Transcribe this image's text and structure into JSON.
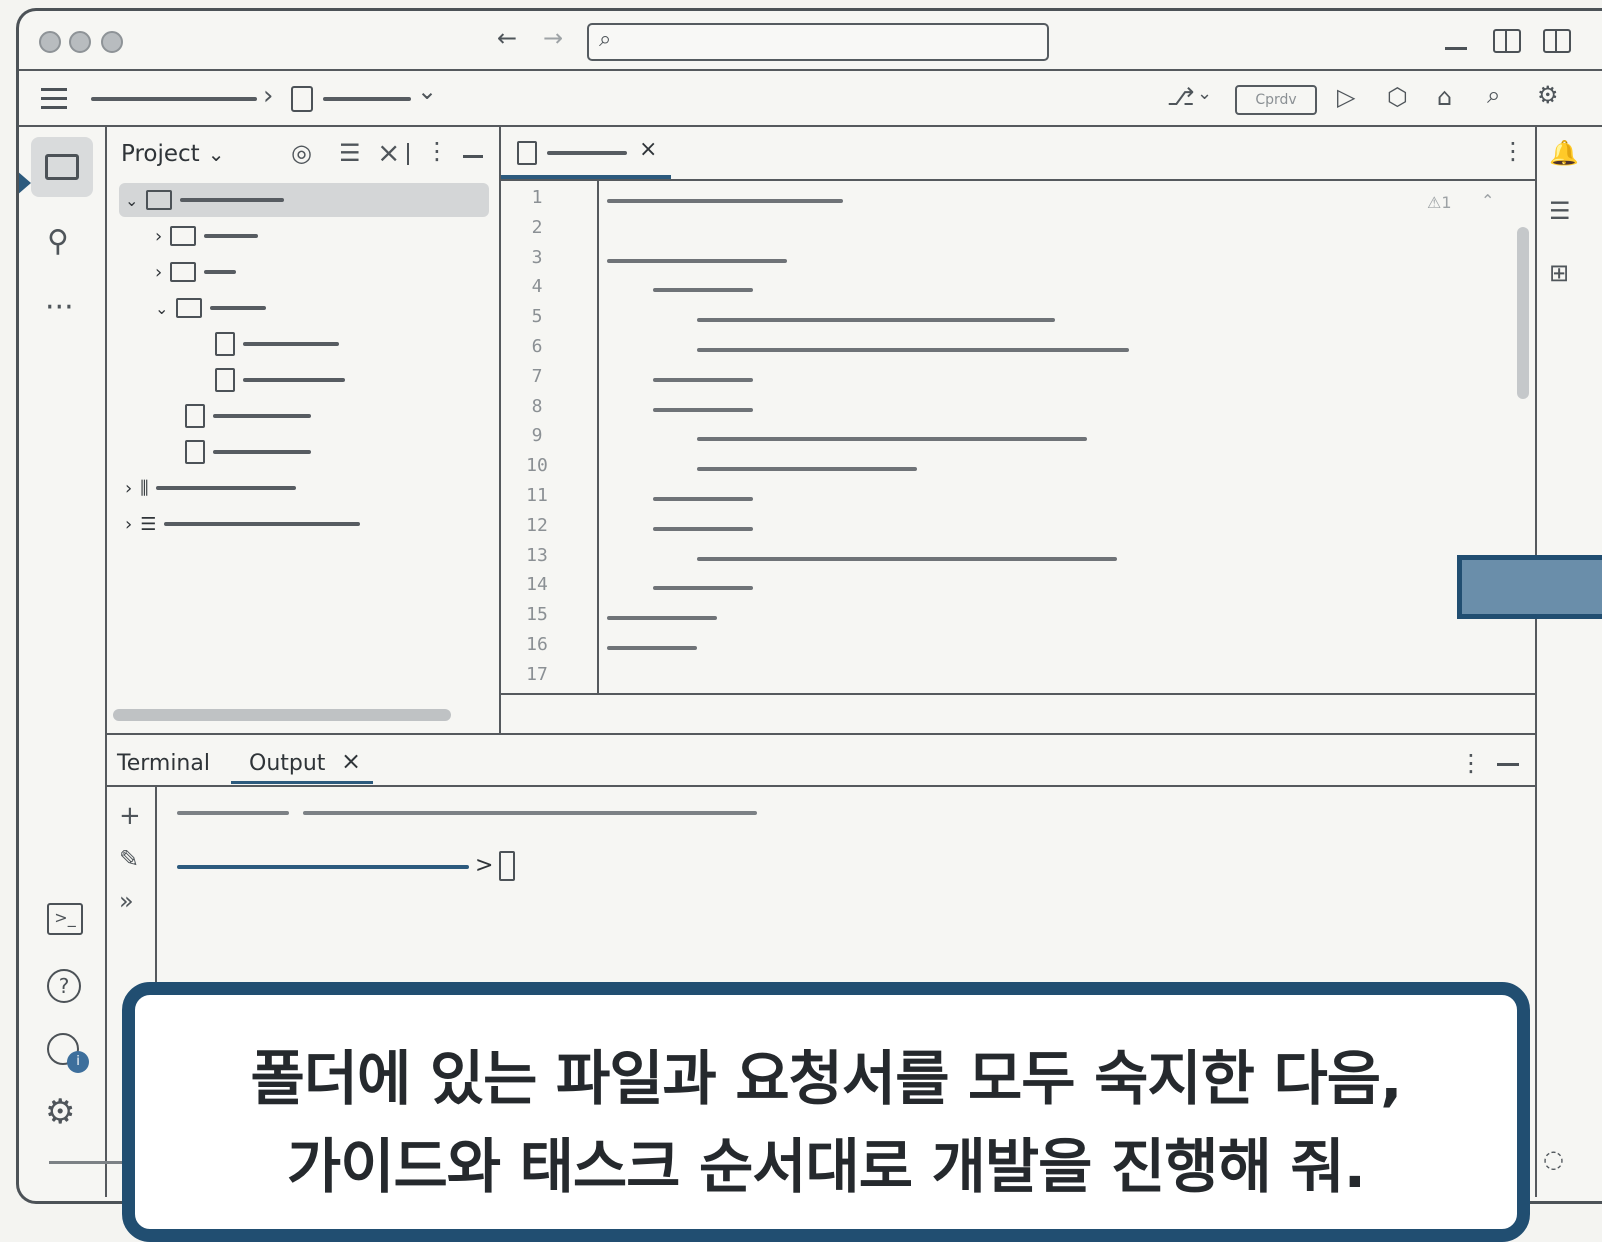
{
  "window": {
    "traffic_lights": [
      "close",
      "minimize",
      "maximize"
    ],
    "search_placeholder": ""
  },
  "toolbar": {
    "menu_icon": "hamburger-icon",
    "breadcrumb_sep": "›",
    "breadcrumb_caret": "⌄",
    "center_pill": "Cprdv",
    "actions": [
      "branch",
      "run",
      "debug",
      "profile",
      "search",
      "settings"
    ]
  },
  "project_panel": {
    "title": "Project",
    "title_caret": "⌄",
    "tree": [
      {
        "icon": "folder-icon",
        "expanded": true,
        "level": 0
      },
      {
        "icon": "folder-icon",
        "expanded": false,
        "level": 1
      },
      {
        "icon": "folder-icon",
        "expanded": false,
        "level": 1
      },
      {
        "icon": "folder-icon",
        "expanded": true,
        "level": 1
      },
      {
        "icon": "file-icon",
        "level": 2
      },
      {
        "icon": "file-icon",
        "level": 2
      },
      {
        "icon": "file-icon",
        "level": 1
      },
      {
        "icon": "file-icon",
        "level": 1
      },
      {
        "icon": "library-icon",
        "expanded": false,
        "level": 0
      },
      {
        "icon": "scratches-icon",
        "expanded": false,
        "level": 0
      }
    ]
  },
  "editor": {
    "tab_close": "×",
    "warning": "⚠1",
    "line_numbers": [
      "1",
      "2",
      "3",
      "4",
      "5",
      "6",
      "7",
      "8",
      "9",
      "10",
      "11",
      "12",
      "13",
      "14",
      "15",
      "16",
      "17"
    ]
  },
  "bottom_panel": {
    "tabs": [
      "Terminal",
      "Output"
    ],
    "active_tab": "Output",
    "close": "×",
    "prompt": ">"
  },
  "callout": {
    "line1": "폴더에 있는 파일과 요청서를 모두 숙지한 다음,",
    "line2": "가이드와 태스크 순서대로 개발을 진행해 줘."
  }
}
